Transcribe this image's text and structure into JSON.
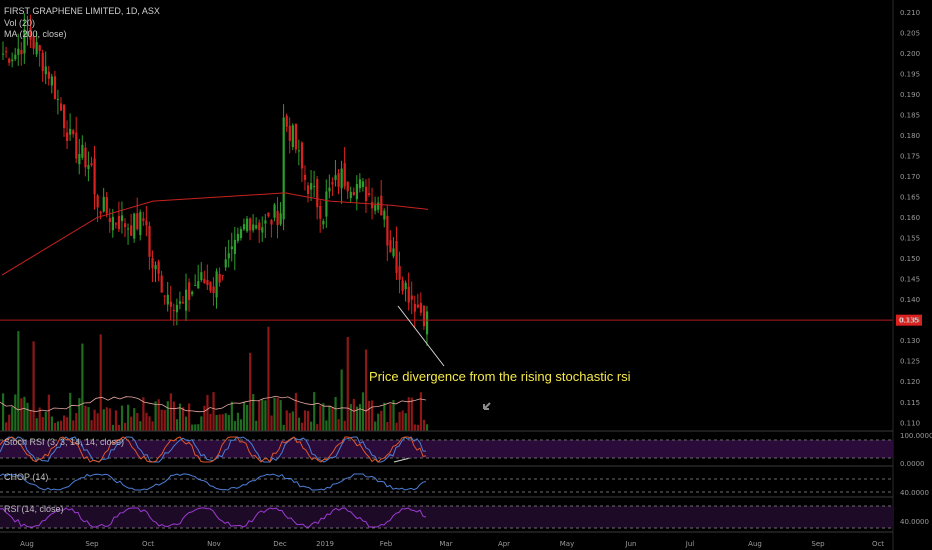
{
  "header": {
    "title": "FIRST GRAPHENE LIMITED, 1D, ASX",
    "study_vol": "Vol (20)",
    "study_ma": "MA (200, close)"
  },
  "panes": {
    "stoch": "Stoch RSI (3, 3, 14, 14, close)",
    "chop": "CHOP (14)",
    "rsi": "RSI (14, close)"
  },
  "annotation": "Price divergence from the rising stochastic rsi",
  "colors": {
    "up": "#2e9e2e",
    "down": "#d9221f",
    "ma": "#c8221f",
    "hline": "#b11a1a",
    "stoch_k": "#4c7fd6",
    "stoch_d": "#e0562b",
    "chop": "#4c7fd6",
    "rsi": "#9b3bd0",
    "band": "#2a0b3a",
    "last_price_bg": "#d9221f"
  },
  "chart_data": {
    "type": "candlestick",
    "title": "FIRST GRAPHENE LIMITED, 1D, ASX",
    "price_axis": {
      "ticks": [
        "0.210",
        "0.205",
        "0.200",
        "0.195",
        "0.190",
        "0.185",
        "0.180",
        "0.175",
        "0.170",
        "0.165",
        "0.160",
        "0.155",
        "0.150",
        "0.145",
        "0.140",
        "0.135",
        "0.130",
        "0.125",
        "0.120",
        "0.115",
        "0.110"
      ],
      "range": [
        0.108,
        0.213
      ],
      "last_price": "0.135"
    },
    "x_axis": {
      "labels": [
        "Aug",
        "Sep",
        "Oct",
        "Nov",
        "Dec",
        "2019",
        "Feb",
        "Mar",
        "Apr",
        "May",
        "Jun",
        "Jul",
        "Aug",
        "Sep",
        "Oct"
      ]
    },
    "price_path": [
      [
        "Jul",
        0.2
      ],
      [
        "Aug",
        0.205
      ],
      [
        "Aug",
        0.195
      ],
      [
        "Aug",
        0.178
      ],
      [
        "Aug",
        0.172
      ],
      [
        "Sep",
        0.165
      ],
      [
        "Sep",
        0.16
      ],
      [
        "Sep",
        0.158
      ],
      [
        "Sep",
        0.16
      ],
      [
        "Oct",
        0.15
      ],
      [
        "Oct",
        0.142
      ],
      [
        "Oct",
        0.138
      ],
      [
        "Oct",
        0.145
      ],
      [
        "Oct",
        0.143
      ],
      [
        "Nov",
        0.145
      ],
      [
        "Nov",
        0.15
      ],
      [
        "Nov",
        0.16
      ],
      [
        "Nov",
        0.158
      ],
      [
        "Nov",
        0.162
      ],
      [
        "Dec",
        0.185
      ],
      [
        "Dec",
        0.18
      ],
      [
        "Dec",
        0.17
      ],
      [
        "Dec",
        0.165
      ],
      [
        "Dec",
        0.16
      ],
      [
        "2019",
        0.165
      ],
      [
        "2019",
        0.17
      ],
      [
        "2019",
        0.168
      ],
      [
        "2019",
        0.165
      ],
      [
        "2019",
        0.162
      ],
      [
        "Feb",
        0.155
      ],
      [
        "Feb",
        0.148
      ],
      [
        "Feb",
        0.142
      ],
      [
        "Feb",
        0.138
      ],
      [
        "Feb",
        0.135
      ]
    ],
    "ma_path": [
      [
        "Jul",
        0.146
      ],
      [
        "Sep",
        0.16
      ],
      [
        "Oct",
        0.164
      ],
      [
        "Nov",
        0.165
      ],
      [
        "Dec",
        0.166
      ],
      [
        "2019",
        0.164
      ],
      [
        "Feb",
        0.163
      ],
      [
        "Feb",
        0.162
      ]
    ],
    "indicators": {
      "stoch_rsi": {
        "label": "Stoch RSI (3, 3, 14, 14, close)",
        "ticks": [
          "100.0000",
          "0.0000"
        ]
      },
      "chop": {
        "label": "CHOP (14)",
        "ticks": [
          "40.0000"
        ]
      },
      "rsi": {
        "label": "RSI (14, close)",
        "ticks": [
          "40.0000"
        ]
      }
    }
  }
}
